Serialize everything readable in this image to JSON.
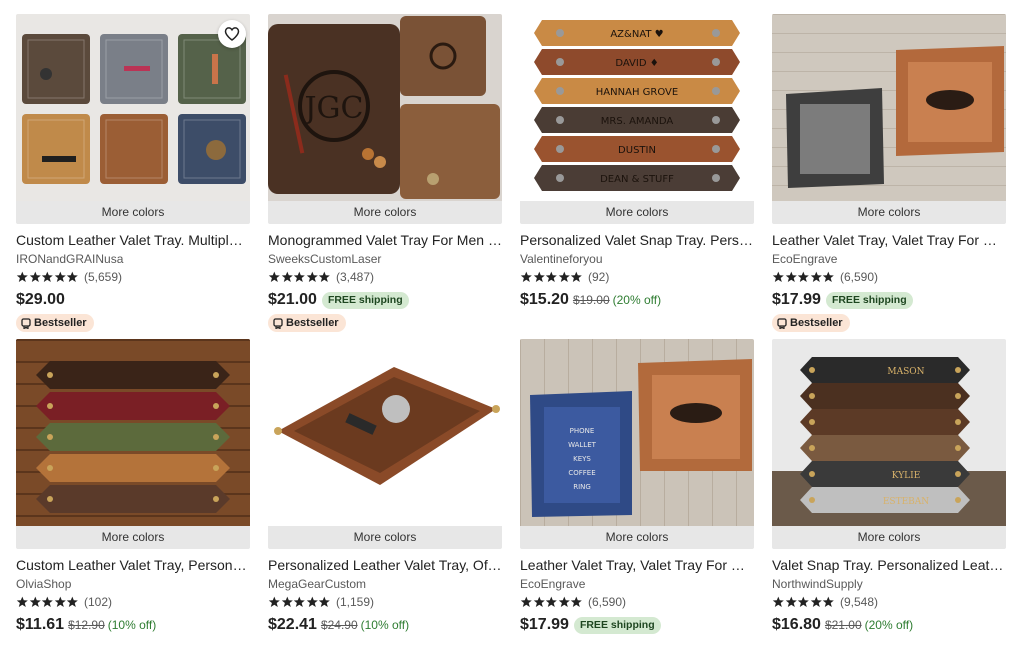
{
  "more_colors_label": "More colors",
  "free_shipping_label": "FREE shipping",
  "bestseller_label": "Bestseller",
  "colors": {
    "star": "#222222",
    "discount": "#2f7d32",
    "free_ship_bg": "#d4e9d1",
    "bestseller_bg": "#fbe5d6"
  },
  "icons": {
    "favorite": "heart-icon",
    "rating": "star-icon",
    "bestseller": "medal-icon"
  },
  "products": [
    {
      "title": "Custom Leather Valet Tray. Multiple ...",
      "shop": "IRONandGRAINusa",
      "rating_count": "(5,659)",
      "stars": 5,
      "price": "$29.00",
      "original": "",
      "discount": "",
      "free_shipping": false,
      "bestseller": true,
      "favorite": true,
      "img": "tiles"
    },
    {
      "title": "Monogrammed Valet Tray For Men P...",
      "shop": "SweeksCustomLaser",
      "rating_count": "(3,487)",
      "stars": 5,
      "price": "$21.00",
      "original": "",
      "discount": "",
      "free_shipping": true,
      "bestseller": true,
      "favorite": false,
      "img": "monogram"
    },
    {
      "title": "Personalized Valet Snap Tray. Perso...",
      "shop": "Valentineforyou",
      "rating_count": "(92)",
      "stars": 5,
      "price": "$15.20",
      "original": "$19.00",
      "discount": "(20% off)",
      "free_shipping": false,
      "bestseller": false,
      "favorite": false,
      "img": "straps"
    },
    {
      "title": "Leather Valet Tray, Valet Tray For Me...",
      "shop": "EcoEngrave",
      "rating_count": "(6,590)",
      "stars": 5,
      "price": "$17.99",
      "original": "",
      "discount": "",
      "free_shipping": true,
      "bestseller": true,
      "favorite": false,
      "img": "twotrays"
    },
    {
      "title": "Custom Leather Valet Tray, Personal...",
      "shop": "OlviaShop",
      "rating_count": "(102)",
      "stars": 5,
      "price": "$11.61",
      "original": "$12.90",
      "discount": "(10% off)",
      "free_shipping": false,
      "bestseller": false,
      "favorite": false,
      "img": "stack"
    },
    {
      "title": "Personalized Leather Valet Tray, Offi...",
      "shop": "MegaGearCustom",
      "rating_count": "(1,159)",
      "stars": 5,
      "price": "$22.41",
      "original": "$24.90",
      "discount": "(10% off)",
      "free_shipping": false,
      "bestseller": false,
      "favorite": false,
      "img": "single"
    },
    {
      "title": "Leather Valet Tray, Valet Tray For Me...",
      "shop": "EcoEngrave",
      "rating_count": "(6,590)",
      "stars": 5,
      "price": "$17.99",
      "original": "",
      "discount": "",
      "free_shipping": true,
      "bestseller": false,
      "favorite": false,
      "img": "bluetray"
    },
    {
      "title": "Valet Snap Tray. Personalized Leath...",
      "shop": "NorthwindSupply",
      "rating_count": "(9,548)",
      "stars": 5,
      "price": "$16.80",
      "original": "$21.00",
      "discount": "(20% off)",
      "free_shipping": false,
      "bestseller": false,
      "favorite": false,
      "img": "namedstack"
    }
  ]
}
